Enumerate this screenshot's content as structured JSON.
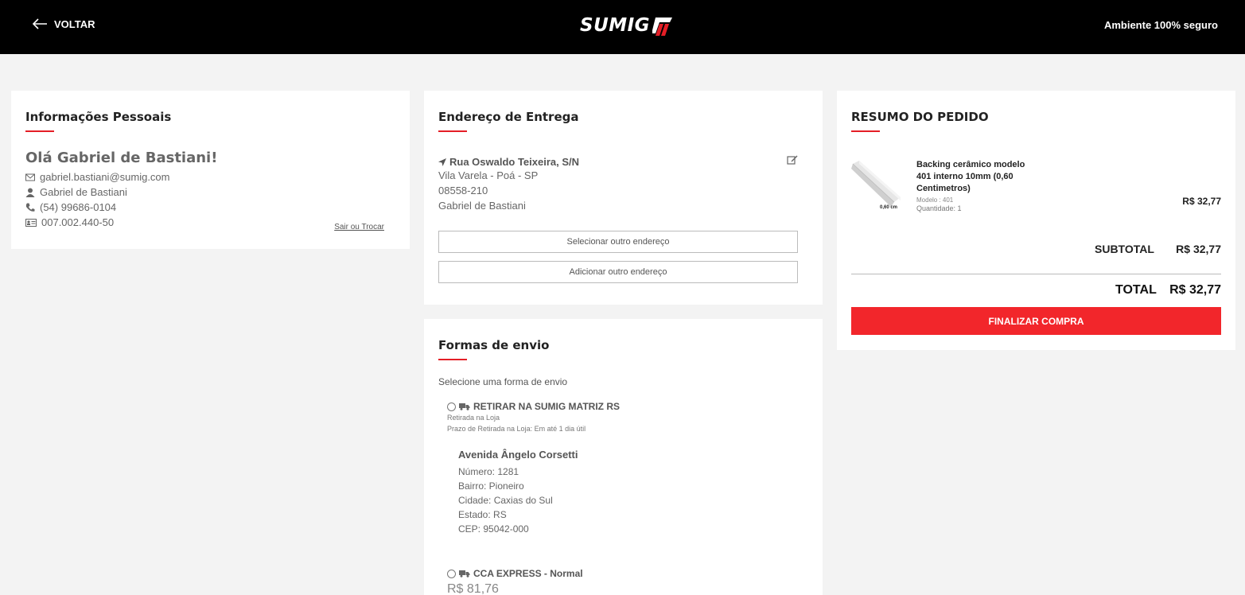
{
  "header": {
    "back_label": "VOLTAR",
    "logo_text": "SUMIG",
    "secure_label": "Ambiente 100% seguro"
  },
  "personal": {
    "title": "Informações Pessoais",
    "greeting": "Olá Gabriel de Bastiani!",
    "email": "gabriel.bastiani@sumig.com",
    "name": "Gabriel de Bastiani",
    "phone": "(54) 99686-0104",
    "document": "007.002.440-50",
    "logout_label": "Sair ou Trocar"
  },
  "address": {
    "title": "Endereço de Entrega",
    "street": "Rua Oswaldo Teixeira, S/N",
    "district_city": "Vila Varela - Poá - SP",
    "zip": "08558-210",
    "recipient": "Gabriel de Bastiani",
    "select_other_label": "Selecionar outro endereço",
    "add_other_label": "Adicionar outro endereço"
  },
  "shipping": {
    "title": "Formas de envio",
    "prompt": "Selecione uma forma de envio",
    "options": [
      {
        "name": "RETIRAR NA SUMIG MATRIZ RS",
        "subtitle": "Retirada na Loja",
        "detail": "Prazo de Retirada na Loja: Em até 1 dia útil"
      },
      {
        "name": "CCA EXPRESS - Normal",
        "price": "R$ 81,76"
      }
    ],
    "store": {
      "name": "Avenida Ângelo Corsetti",
      "number": "Número: 1281",
      "district": "Bairro: Pioneiro",
      "city": "Cidade: Caxias do Sul",
      "state": "Estado: RS",
      "zip": "CEP: 95042-000"
    }
  },
  "summary": {
    "title": "RESUMO DO PEDIDO",
    "product": {
      "name": "Backing cerâmico modelo 401 interno 10mm (0,60 Centimetros)",
      "image_label": "0,60 cm",
      "model": "Modelo : 401",
      "quantity": "Quantidade: 1",
      "price": "R$ 32,77"
    },
    "subtotal_label": "SUBTOTAL",
    "subtotal_value": "R$ 32,77",
    "total_label": "TOTAL",
    "total_value": "R$ 32,77",
    "finalize_label": "FINALIZAR COMPRA"
  },
  "colors": {
    "accent": "#e41e26",
    "button": "#f2262b",
    "header_bg": "#000000"
  }
}
